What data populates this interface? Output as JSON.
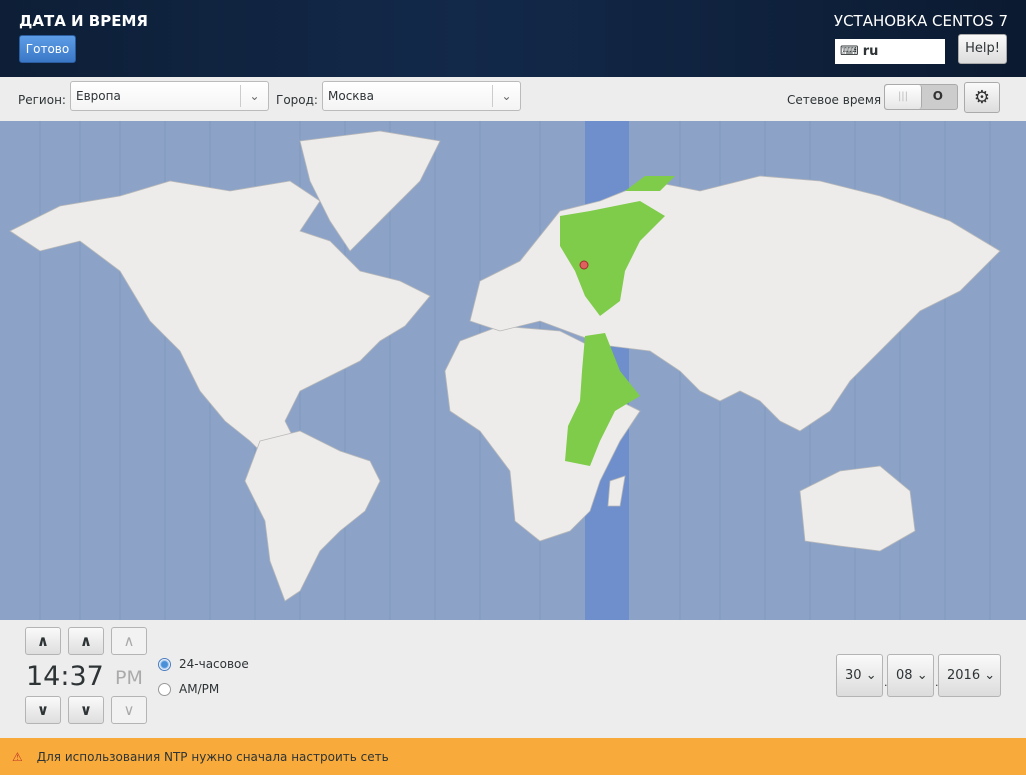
{
  "header": {
    "title": "ДАТА И ВРЕМЯ",
    "done_label": "Готово",
    "product": "УСТАНОВКА CENTOS 7",
    "keyboard_layout": "ru",
    "help_label": "Help!"
  },
  "toolbar": {
    "region_label": "Регион:",
    "region_value": "Европа",
    "city_label": "Город:",
    "city_value": "Москва",
    "network_time_label": "Сетевое время",
    "network_time_on": false
  },
  "time": {
    "value": "14:37",
    "ampm": "PM",
    "format_24": "24-часовое",
    "format_ampm": "AM/PM",
    "selected_format": "24-часовое"
  },
  "date": {
    "day": "30",
    "month": "08",
    "year": "2016",
    "separator": "."
  },
  "warning": {
    "text": "Для использования NTP нужно сначала настроить сеть"
  },
  "colors": {
    "map_water": "#8ca3c7",
    "timezone_band": "#6e8fcb",
    "highlight": "#7fcc4a",
    "warning": "#f8ab3a"
  }
}
